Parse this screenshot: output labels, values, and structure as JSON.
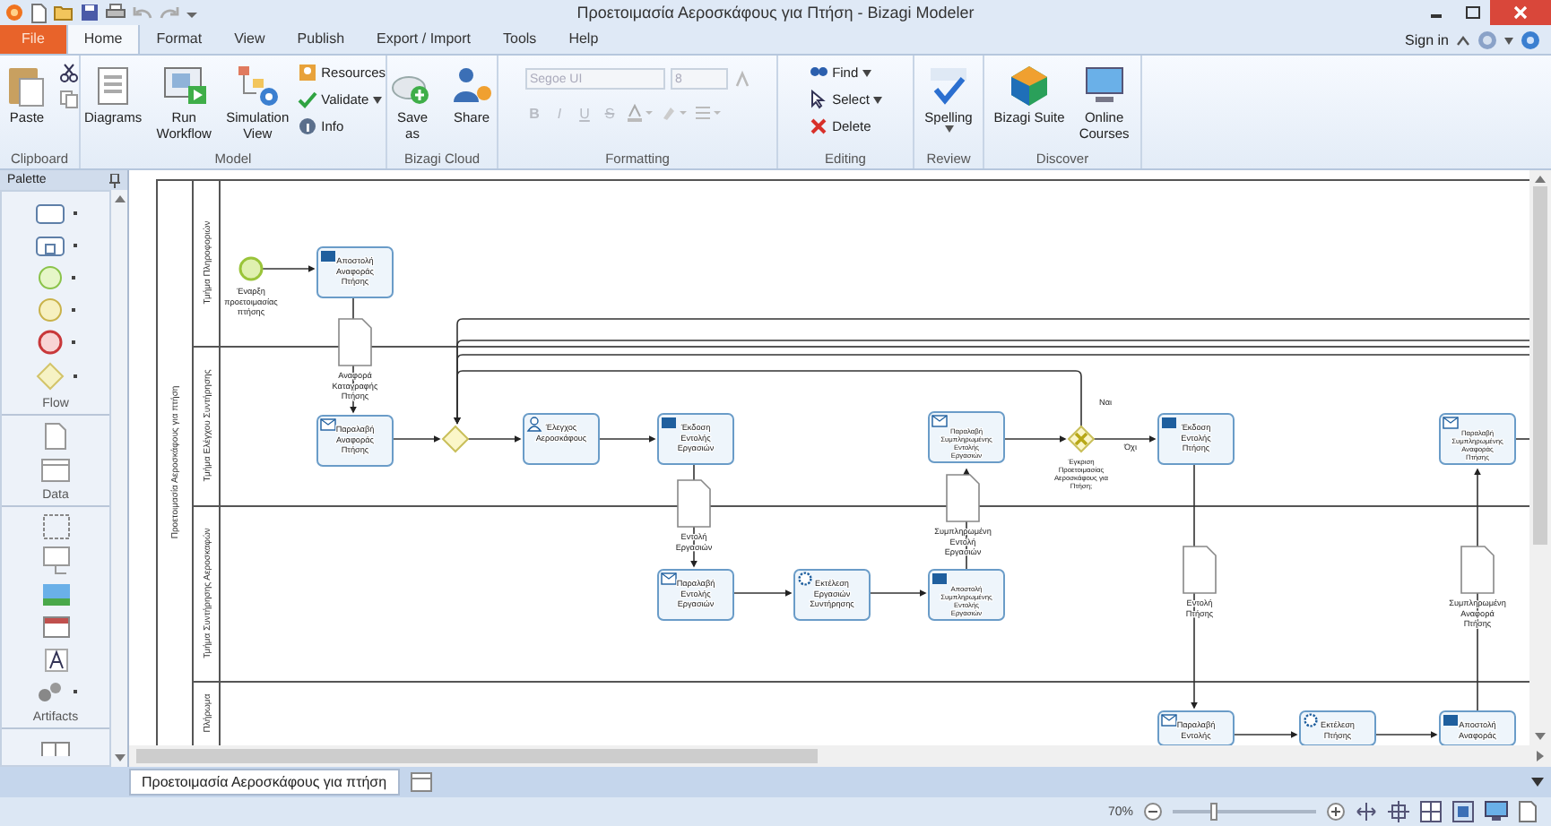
{
  "window": {
    "title": "Προετοιμασία Αεροσκάφους για Πτήση - Bizagi Modeler"
  },
  "ribbon_tabs": [
    {
      "label": "File",
      "kind": "file",
      "selected": false
    },
    {
      "label": "Home",
      "kind": "tab",
      "selected": true
    },
    {
      "label": "Format",
      "kind": "tab",
      "selected": false
    },
    {
      "label": "View",
      "kind": "tab",
      "selected": false
    },
    {
      "label": "Publish",
      "kind": "tab",
      "selected": false
    },
    {
      "label": "Export / Import",
      "kind": "tab",
      "selected": false
    },
    {
      "label": "Tools",
      "kind": "tab",
      "selected": false
    },
    {
      "label": "Help",
      "kind": "tab",
      "selected": false
    }
  ],
  "account": {
    "sign_in": "Sign in"
  },
  "ribbon_groups": [
    {
      "label": "Clipboard",
      "buttons": [
        {
          "label": "Paste",
          "kind": "large"
        },
        {
          "kind": "icon"
        },
        {
          "kind": "icon"
        }
      ]
    },
    {
      "label": "Model",
      "buttons": [
        {
          "label": "Diagrams",
          "kind": "large"
        },
        {
          "label": "Run Workflow",
          "kind": "large"
        },
        {
          "label": "Simulation View",
          "kind": "large"
        },
        {
          "label": "Resources",
          "kind": "small"
        },
        {
          "label": "Validate",
          "kind": "small"
        },
        {
          "label": "Info",
          "kind": "small"
        }
      ]
    },
    {
      "label": "Bizagi Cloud",
      "buttons": [
        {
          "label": "Save as",
          "kind": "large"
        },
        {
          "label": "Share",
          "kind": "large"
        }
      ]
    },
    {
      "label": "Formatting",
      "font_field": {
        "value": "Segoe UI",
        "disabled": true
      },
      "size_field": {
        "value": "8",
        "disabled": true
      },
      "format_buttons": [
        {
          "label": "B",
          "disabled": true
        },
        {
          "label": "I",
          "disabled": true
        },
        {
          "label": "U",
          "disabled": true
        },
        {
          "label": "S",
          "disabled": true
        }
      ]
    },
    {
      "label": "Editing",
      "buttons": [
        {
          "label": "Find",
          "kind": "small"
        },
        {
          "label": "Select",
          "kind": "small"
        },
        {
          "label": "Delete",
          "kind": "small"
        }
      ]
    },
    {
      "label": "Review",
      "buttons": [
        {
          "label": "Spelling",
          "kind": "large"
        }
      ]
    },
    {
      "label": "Discover",
      "buttons": [
        {
          "label": "Bizagi Suite",
          "kind": "large"
        },
        {
          "label": "Online Courses",
          "kind": "large"
        }
      ]
    }
  ],
  "palette": {
    "title": "Palette",
    "sections": [
      "Flow",
      "Data",
      "Artifacts"
    ]
  },
  "diagram": {
    "pool": "Προετοιμασία Αεροσκάφους για πτήση",
    "lanes": [
      "Τμήμα Πληροφοριών",
      "Τμήμα Ελέγχου Συντήρησης",
      "Τμήμα Συντήρησης Αεροσκαφών",
      "Πλήρωμα"
    ],
    "nodes": [
      {
        "kind": "start",
        "lines": [
          "Έναρξη",
          "προετοιμασίας",
          "πτήσης"
        ]
      },
      {
        "kind": "send",
        "lines": [
          "Αποστολή",
          "Αναφοράς",
          "Πτήσης"
        ]
      },
      {
        "kind": "data",
        "lines": [
          "Αναφορά",
          "Καταγραφής",
          "Πτήσης"
        ]
      },
      {
        "kind": "receive",
        "lines": [
          "Παραλαβή",
          "Αναφοράς",
          "Πτήσης"
        ]
      },
      {
        "kind": "gateway"
      },
      {
        "kind": "user",
        "lines": [
          "Έλεγχος",
          "Αεροσκάφους"
        ]
      },
      {
        "kind": "send",
        "lines": [
          "Έκδοση",
          "Εντολής",
          "Εργασιών"
        ]
      },
      {
        "kind": "data",
        "lines": [
          "Εντολή",
          "Εργασιών"
        ]
      },
      {
        "kind": "receive",
        "lines": [
          "Παραλαβή",
          "Εντολής",
          "Εργασιών"
        ]
      },
      {
        "kind": "service",
        "lines": [
          "Εκτέλεση",
          "Εργασιών",
          "Συντήρησης"
        ]
      },
      {
        "kind": "receive",
        "lines": [
          "Παραλαβή",
          "Συμπληρωμένης",
          "Εντολής",
          "Εργασιών"
        ]
      },
      {
        "kind": "data",
        "lines": [
          "Συμπληρωμένη",
          "Εντολή",
          "Εργασιών"
        ]
      },
      {
        "kind": "send",
        "lines": [
          "Αποστολή",
          "Συμπληρωμένης",
          "Εντολής",
          "Εργασιών"
        ]
      },
      {
        "kind": "xor",
        "lines": [
          "Έγκριση",
          "Προετοιμασίας",
          "Αεροσκάφους για",
          "Πτήση;"
        ]
      },
      {
        "kind": "send",
        "lines": [
          "Έκδοση",
          "Εντολής",
          "Πτήσης"
        ]
      },
      {
        "kind": "data",
        "lines": [
          "Εντολή",
          "Πτήσης"
        ]
      },
      {
        "kind": "receive",
        "lines": [
          "Παραλαβή",
          "Εντολής"
        ]
      },
      {
        "kind": "service",
        "lines": [
          "Εκτέλεση",
          "Πτήσης"
        ]
      },
      {
        "kind": "receive",
        "lines": [
          "Παραλαβή",
          "Συμπληρωμένης",
          "Αναφοράς",
          "Πτήσης"
        ]
      },
      {
        "kind": "data",
        "lines": [
          "Συμπληρωμένη",
          "Αναφορά",
          "Πτήσης"
        ]
      },
      {
        "kind": "send",
        "lines": [
          "Αποστολή",
          "Αναφοράς"
        ]
      }
    ],
    "flow_labels": [
      "Ναι",
      "Όχι"
    ]
  },
  "document_tabs": [
    {
      "label": "Προετοιμασία Αεροσκάφους για πτήση",
      "selected": true
    }
  ],
  "status_bar": {
    "zoom": "70%",
    "zoom_slider": {
      "level": 0.3
    }
  }
}
